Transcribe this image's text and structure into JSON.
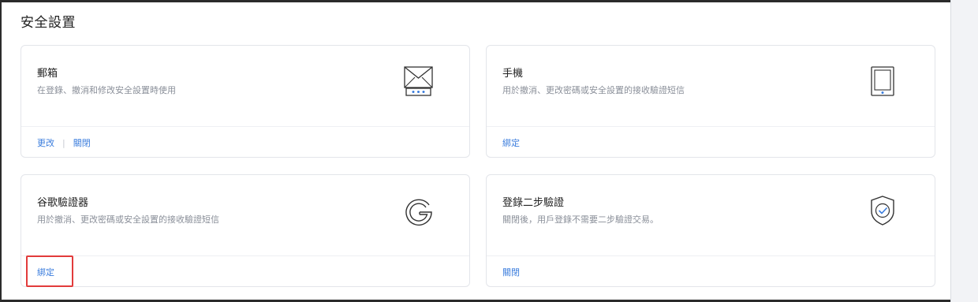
{
  "page": {
    "title": "安全設置"
  },
  "cards": {
    "email": {
      "title": "郵箱",
      "desc": "在登錄、撤消和修改安全設置時使用",
      "icon": "envelope-icon",
      "actions": [
        "更改",
        "關閉"
      ]
    },
    "phone": {
      "title": "手機",
      "desc": "用於撤消、更改密碼或安全設置的接收驗證短信",
      "icon": "phone-icon",
      "actions": [
        "綁定"
      ]
    },
    "google": {
      "title": "谷歌驗證器",
      "desc": "用於撤消、更改密碼或安全設置的接收驗證短信",
      "icon": "google-icon",
      "actions": [
        "綁定"
      ]
    },
    "twostep": {
      "title": "登錄二步驗證",
      "desc": "關閉後，用戶登錄不需要二步驗證交易。",
      "icon": "shield-check-icon",
      "actions": [
        "關閉"
      ]
    }
  },
  "colors": {
    "accent": "#3b7ddd",
    "highlight": "#e23b3b"
  }
}
